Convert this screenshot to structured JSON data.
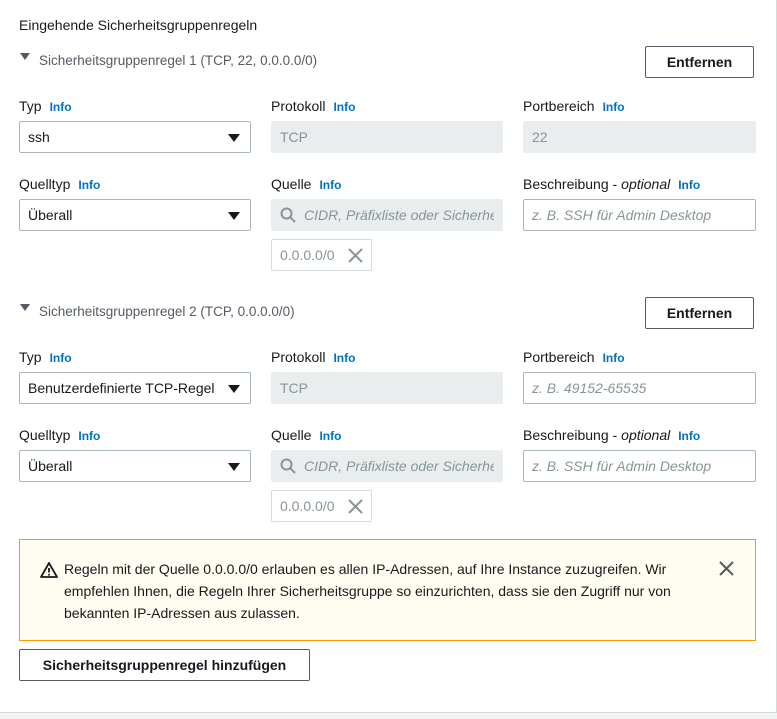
{
  "section_title": "Eingehende Sicherheitsgruppenregeln",
  "labels": {
    "type": "Typ",
    "protocol": "Protokoll",
    "port_range": "Portbereich",
    "source_type": "Quelltyp",
    "source": "Quelle",
    "description": "Beschreibung -",
    "optional": "optional",
    "info": "Info"
  },
  "remove_label": "Entfernen",
  "rules": [
    {
      "header": "Sicherheitsgruppenregel 1 (TCP, 22, 0.0.0.0/0)",
      "type_value": "ssh",
      "protocol_value": "TCP",
      "port_value": "22",
      "port_placeholder": "",
      "source_type_value": "Überall",
      "source_placeholder": "CIDR, Präfixliste oder Sicherhei",
      "description_placeholder": "z. B. SSH für Admin Desktop",
      "token": "0.0.0.0/0"
    },
    {
      "header": "Sicherheitsgruppenregel 2 (TCP, 0.0.0.0/0)",
      "type_value": "Benutzerdefinierte TCP-Regel",
      "protocol_value": "TCP",
      "port_value": "",
      "port_placeholder": "z. B. 49152-65535",
      "source_type_value": "Überall",
      "source_placeholder": "CIDR, Präfixliste oder Sicherhei",
      "description_placeholder": "z. B. SSH für Admin Desktop",
      "token": "0.0.0.0/0"
    }
  ],
  "warning": {
    "text": "Regeln mit der Quelle 0.0.0.0/0 erlauben es allen IP-Adressen, auf Ihre Instance zuzugreifen. Wir empfehlen Ihnen, die Regeln Ihrer Sicherheitsgruppe so einzurichten, dass sie den Zugriff nur von bekannten IP-Adressen aus zulassen.",
    "icon": "warning-icon",
    "close_icon": "close-icon"
  },
  "add_rule_label": "Sicherheitsgruppenregel hinzufügen",
  "colors": {
    "link": "#0073bb",
    "warning_border": "#ff9900",
    "warning_bg": "#fffdf1",
    "disabled_bg": "#eaeded"
  }
}
